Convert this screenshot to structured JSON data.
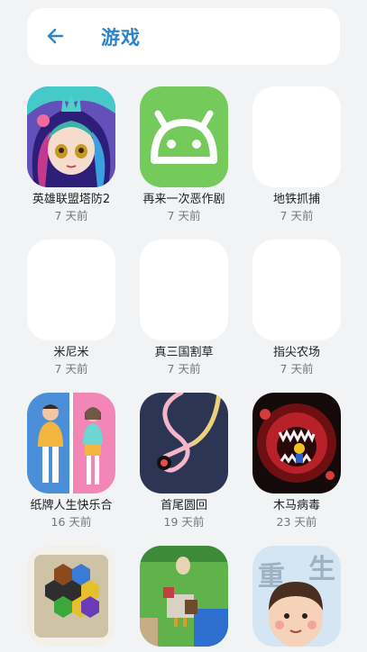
{
  "header": {
    "title": "游戏",
    "back_icon": "arrow-left-icon",
    "accent_color": "#2f84c8"
  },
  "apps": [
    {
      "name": "英雄联盟塔防2",
      "time": "7 天前",
      "icon": "anime-girl-icon"
    },
    {
      "name": "再来一次恶作剧",
      "time": "7 天前",
      "icon": "android-icon"
    },
    {
      "name": "地铁抓捕",
      "time": "7 天前",
      "icon": "blank-icon"
    },
    {
      "name": "米尼米",
      "time": "7 天前",
      "icon": "blank-icon"
    },
    {
      "name": "真三国割草",
      "time": "7 天前",
      "icon": "blank-icon"
    },
    {
      "name": "指尖农场",
      "time": "7 天前",
      "icon": "blank-icon"
    },
    {
      "name": "纸牌人生快乐合",
      "time": "16 天前",
      "icon": "couple-cards-icon"
    },
    {
      "name": "首尾圆回",
      "time": "19 天前",
      "icon": "loop-line-icon"
    },
    {
      "name": "木马病毒",
      "time": "23 天前",
      "icon": "virus-monster-icon"
    },
    {
      "name": "",
      "time": "",
      "icon": "hexagon-puzzle-icon"
    },
    {
      "name": "",
      "time": "",
      "icon": "pixel-chicken-icon"
    },
    {
      "name": "",
      "time": "",
      "icon": "boy-face-icon"
    }
  ]
}
